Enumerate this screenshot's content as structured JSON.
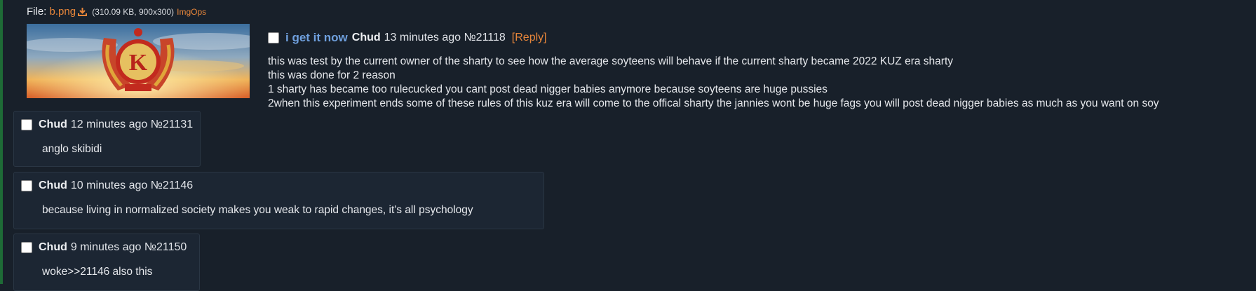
{
  "file": {
    "label": "File:",
    "name": "b.png",
    "meta": "(310.09 KB, 900x300)",
    "imgops": "ImgOps",
    "download_icon": "download-icon"
  },
  "op": {
    "subject": "i get it now",
    "name": "Chud",
    "time": "13 minutes ago",
    "number": "№21118",
    "reply_link": "[Reply]",
    "text": "this was test by the current owner of the sharty to see how the average soyteens will behave if the current sharty became 2022 KUZ era sharty\nthis was done for 2 reason\n1 sharty has became too rulecucked you cant post dead nigger babies anymore because soyteens are huge pussies\n2when this experiment ends some of these rules of this kuz era will come to the offical sharty the jannies wont be huge fags you will post dead nigger babies as much as you want on soy"
  },
  "replies": [
    {
      "name": "Chud",
      "time": "12 minutes ago",
      "number": "№21131",
      "text": "anglo skibidi"
    },
    {
      "name": "Chud",
      "time": "10 minutes ago",
      "number": "№21146",
      "text": "because living in normalized society makes you weak to rapid changes, it's all psychology"
    },
    {
      "name": "Chud",
      "time": "9 minutes ago",
      "number": "№21150",
      "text": "woke>>21146 also this"
    }
  ],
  "colors": {
    "background": "#18202a",
    "reply_background": "#1c2633",
    "link": "#e8863a",
    "subject": "#6fa0de"
  }
}
